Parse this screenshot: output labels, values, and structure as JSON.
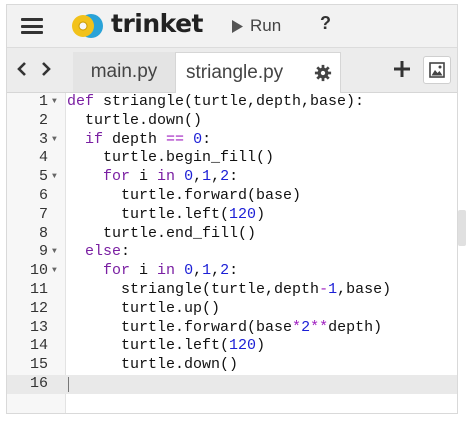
{
  "header": {
    "brand": "trinket",
    "run_label": "Run",
    "help_label": "?"
  },
  "tabs": [
    {
      "label": "main.py",
      "active": false
    },
    {
      "label": "striangle.py",
      "active": true
    }
  ],
  "editor": {
    "lines": [
      {
        "n": "1",
        "fold": true,
        "indent": 0,
        "tokens": [
          [
            "kw",
            "def"
          ],
          [
            "t",
            " striangle(turtle,depth,base):"
          ]
        ]
      },
      {
        "n": "2",
        "fold": false,
        "indent": 1,
        "tokens": [
          [
            "t",
            "turtle.down()"
          ]
        ]
      },
      {
        "n": "3",
        "fold": true,
        "indent": 1,
        "tokens": [
          [
            "kw",
            "if"
          ],
          [
            "t",
            " depth "
          ],
          [
            "op",
            "=="
          ],
          [
            "t",
            " "
          ],
          [
            "num",
            "0"
          ],
          [
            "t",
            ":"
          ]
        ]
      },
      {
        "n": "4",
        "fold": false,
        "indent": 2,
        "tokens": [
          [
            "t",
            "turtle.begin_fill()"
          ]
        ]
      },
      {
        "n": "5",
        "fold": true,
        "indent": 2,
        "tokens": [
          [
            "kw",
            "for"
          ],
          [
            "t",
            " i "
          ],
          [
            "kw",
            "in"
          ],
          [
            "t",
            " "
          ],
          [
            "num",
            "0"
          ],
          [
            "t",
            ","
          ],
          [
            "num",
            "1"
          ],
          [
            "t",
            ","
          ],
          [
            "num",
            "2"
          ],
          [
            "t",
            ":"
          ]
        ]
      },
      {
        "n": "6",
        "fold": false,
        "indent": 3,
        "tokens": [
          [
            "t",
            "turtle.forward(base)"
          ]
        ]
      },
      {
        "n": "7",
        "fold": false,
        "indent": 3,
        "tokens": [
          [
            "t",
            "turtle.left("
          ],
          [
            "num",
            "120"
          ],
          [
            "t",
            ")"
          ]
        ]
      },
      {
        "n": "8",
        "fold": false,
        "indent": 2,
        "tokens": [
          [
            "t",
            "turtle.end_fill()"
          ]
        ]
      },
      {
        "n": "9",
        "fold": true,
        "indent": 1,
        "tokens": [
          [
            "kw",
            "else"
          ],
          [
            "t",
            ":"
          ]
        ]
      },
      {
        "n": "10",
        "fold": true,
        "indent": 2,
        "tokens": [
          [
            "kw",
            "for"
          ],
          [
            "t",
            " i "
          ],
          [
            "kw",
            "in"
          ],
          [
            "t",
            " "
          ],
          [
            "num",
            "0"
          ],
          [
            "t",
            ","
          ],
          [
            "num",
            "1"
          ],
          [
            "t",
            ","
          ],
          [
            "num",
            "2"
          ],
          [
            "t",
            ":"
          ]
        ]
      },
      {
        "n": "11",
        "fold": false,
        "indent": 3,
        "tokens": [
          [
            "t",
            "striangle(turtle,depth"
          ],
          [
            "op",
            "-"
          ],
          [
            "num",
            "1"
          ],
          [
            "t",
            ",base)"
          ]
        ]
      },
      {
        "n": "12",
        "fold": false,
        "indent": 3,
        "tokens": [
          [
            "t",
            "turtle.up()"
          ]
        ]
      },
      {
        "n": "13",
        "fold": false,
        "indent": 3,
        "tokens": [
          [
            "t",
            "turtle.forward(base"
          ],
          [
            "op",
            "*"
          ],
          [
            "num",
            "2"
          ],
          [
            "op",
            "**"
          ],
          [
            "t",
            "depth)"
          ]
        ]
      },
      {
        "n": "14",
        "fold": false,
        "indent": 3,
        "tokens": [
          [
            "t",
            "turtle.left("
          ],
          [
            "num",
            "120"
          ],
          [
            "t",
            ")"
          ]
        ]
      },
      {
        "n": "15",
        "fold": false,
        "indent": 3,
        "tokens": [
          [
            "t",
            "turtle.down()"
          ]
        ]
      },
      {
        "n": "16",
        "fold": false,
        "indent": 0,
        "tokens": [],
        "current": true
      }
    ]
  },
  "icons": {
    "menu": "hamburger-icon",
    "logo": "trinket-logo",
    "run": "play-icon",
    "back": "chevron-left-icon",
    "forward": "chevron-right-icon",
    "settings": "gear-icon",
    "add": "plus-icon",
    "image": "image-icon"
  },
  "colors": {
    "keyword": "#7a1fa2",
    "number": "#1c1fd6",
    "operator": "#a020c0",
    "logo_yellow": "#f2c21b",
    "logo_blue": "#2aa3d8"
  }
}
